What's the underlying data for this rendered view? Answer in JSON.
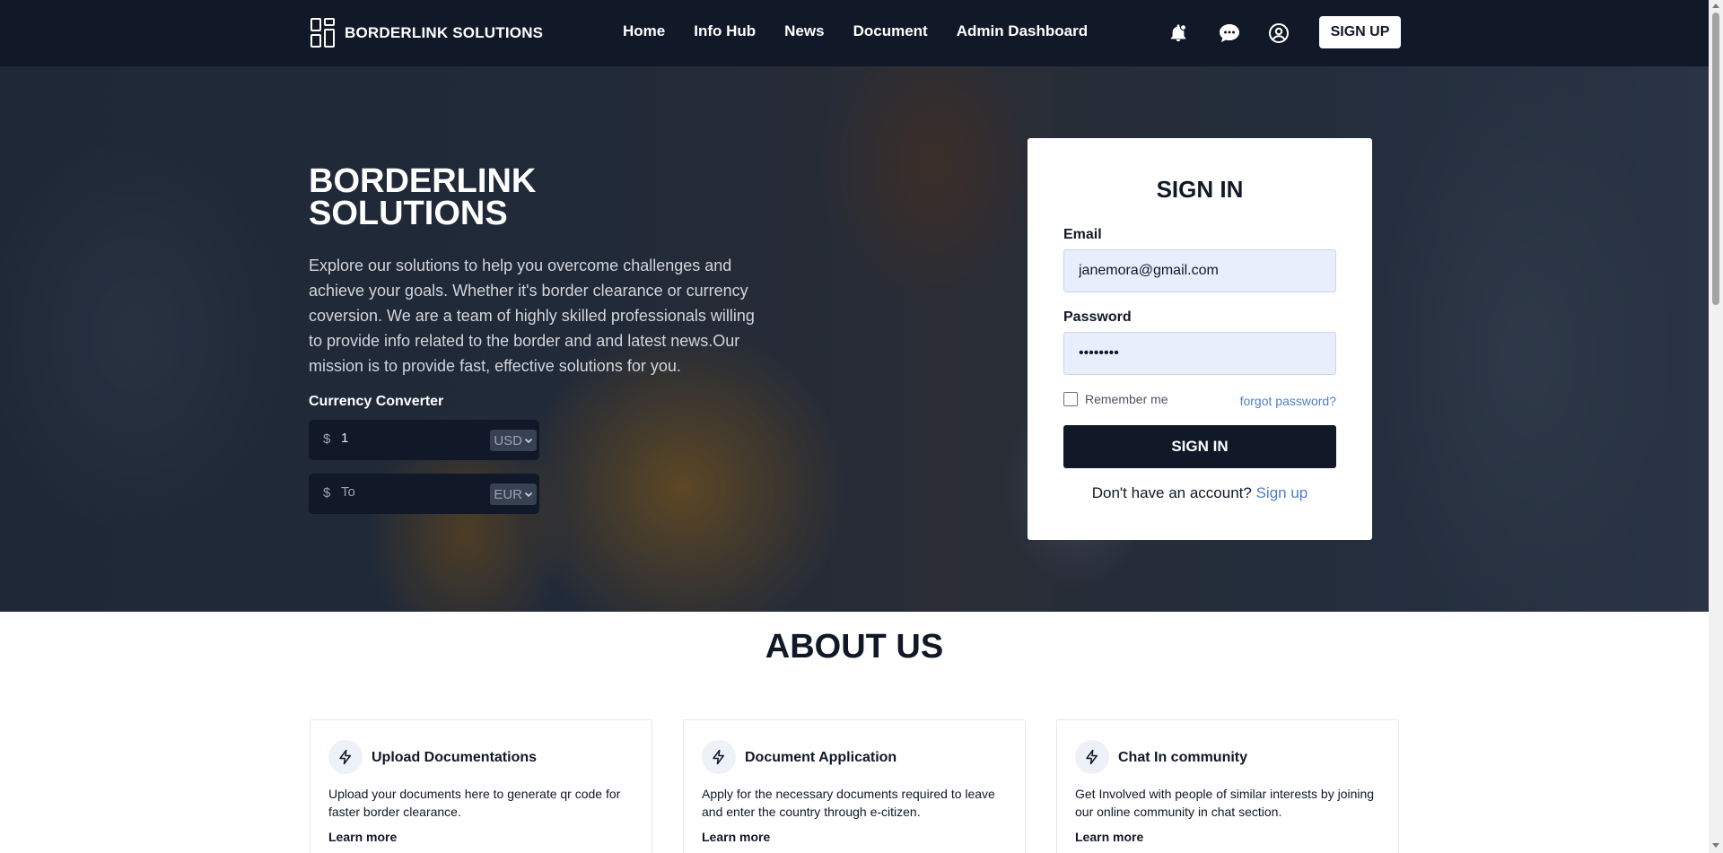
{
  "nav": {
    "brand": "BORDERLINK SOLUTIONS",
    "links": [
      "Home",
      "Info Hub",
      "News",
      "Document",
      "Admin Dashboard"
    ],
    "icons": [
      "bell-icon",
      "chat-icon",
      "user-circle-icon"
    ],
    "signup_label": "SIGN UP"
  },
  "hero": {
    "title": "BORDERLINK SOLUTIONS",
    "description": "Explore our solutions to help you overcome challenges and achieve your goals. Whether it's border clearance or currency coversion. We are a team of highly skilled professionals willing to provide info related to the border and and latest news.Our mission is to provide fast, effective solutions for you.",
    "converter": {
      "label": "Currency Converter",
      "from": {
        "prefix": "$",
        "value": "1",
        "placeholder": "",
        "currency": "USD"
      },
      "to": {
        "prefix": "$",
        "value": "",
        "placeholder": "To",
        "currency": "EUR"
      }
    }
  },
  "signin": {
    "title": "SIGN IN",
    "email_label": "Email",
    "email_value": "janemora@gmail.com",
    "password_label": "Password",
    "password_value": "••••••••",
    "remember_label": "Remember me",
    "forgot_label": "forgot password?",
    "button_label": "SIGN IN",
    "no_account_text": "Don't have an account?",
    "signup_link": "Sign up"
  },
  "about": {
    "title": "ABOUT US",
    "features": [
      {
        "icon": "lightning-icon",
        "title": "Upload Documentations",
        "description": "Upload your documents here to generate qr code for faster border clearance.",
        "link": "Learn more"
      },
      {
        "icon": "lightning-icon",
        "title": "Document Application",
        "description": "Apply for the necessary documents required to leave and enter the country through e-citizen.",
        "link": "Learn more"
      },
      {
        "icon": "lightning-icon",
        "title": "Chat In community",
        "description": "Get Involved with people of similar interests by joining our online community in chat section.",
        "link": "Learn more"
      }
    ]
  },
  "colors": {
    "nav_bg": "#111827",
    "accent_link": "#4f7dc9",
    "input_bg": "#e8eefc"
  }
}
